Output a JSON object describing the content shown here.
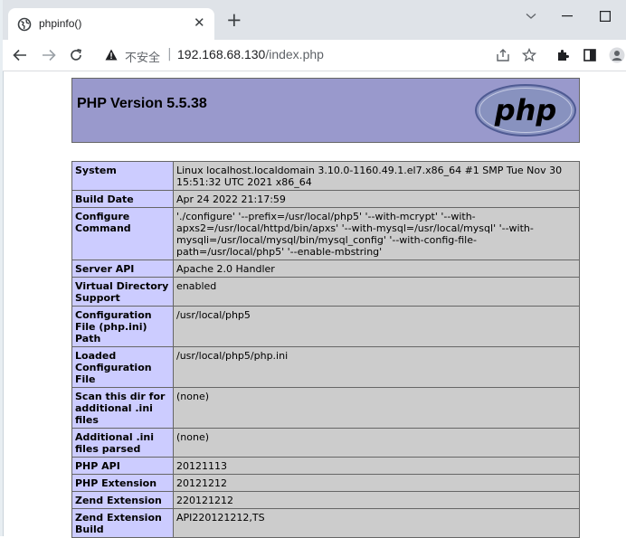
{
  "browser": {
    "tab_title": "phpinfo()",
    "security_label": "不安全",
    "url_host": "192.168.68.130",
    "url_path": "/index.php"
  },
  "page": {
    "heading": "PHP Version 5.5.38",
    "logo_text": "php"
  },
  "table": [
    {
      "key": "System",
      "value": "Linux localhost.localdomain 3.10.0-1160.49.1.el7.x86_64 #1 SMP Tue Nov 30 15:51:32 UTC 2021 x86_64"
    },
    {
      "key": "Build Date",
      "value": "Apr 24 2022 21:17:59"
    },
    {
      "key": "Configure Command",
      "value": "'./configure' '--prefix=/usr/local/php5' '--with-mcrypt' '--with-apxs2=/usr/local/httpd/bin/apxs' '--with-mysql=/usr/local/mysql' '--with-mysqli=/usr/local/mysql/bin/mysql_config' '--with-config-file-path=/usr/local/php5' '--enable-mbstring'"
    },
    {
      "key": "Server API",
      "value": "Apache 2.0 Handler"
    },
    {
      "key": "Virtual Directory Support",
      "value": "enabled"
    },
    {
      "key": "Configuration File (php.ini) Path",
      "value": "/usr/local/php5"
    },
    {
      "key": "Loaded Configuration File",
      "value": "/usr/local/php5/php.ini"
    },
    {
      "key": "Scan this dir for additional .ini files",
      "value": "(none)"
    },
    {
      "key": "Additional .ini files parsed",
      "value": "(none)"
    },
    {
      "key": "PHP API",
      "value": "20121113"
    },
    {
      "key": "PHP Extension",
      "value": "20121212"
    },
    {
      "key": "Zend Extension",
      "value": "220121212"
    },
    {
      "key": "Zend Extension Build",
      "value": "API220121212,TS"
    }
  ]
}
